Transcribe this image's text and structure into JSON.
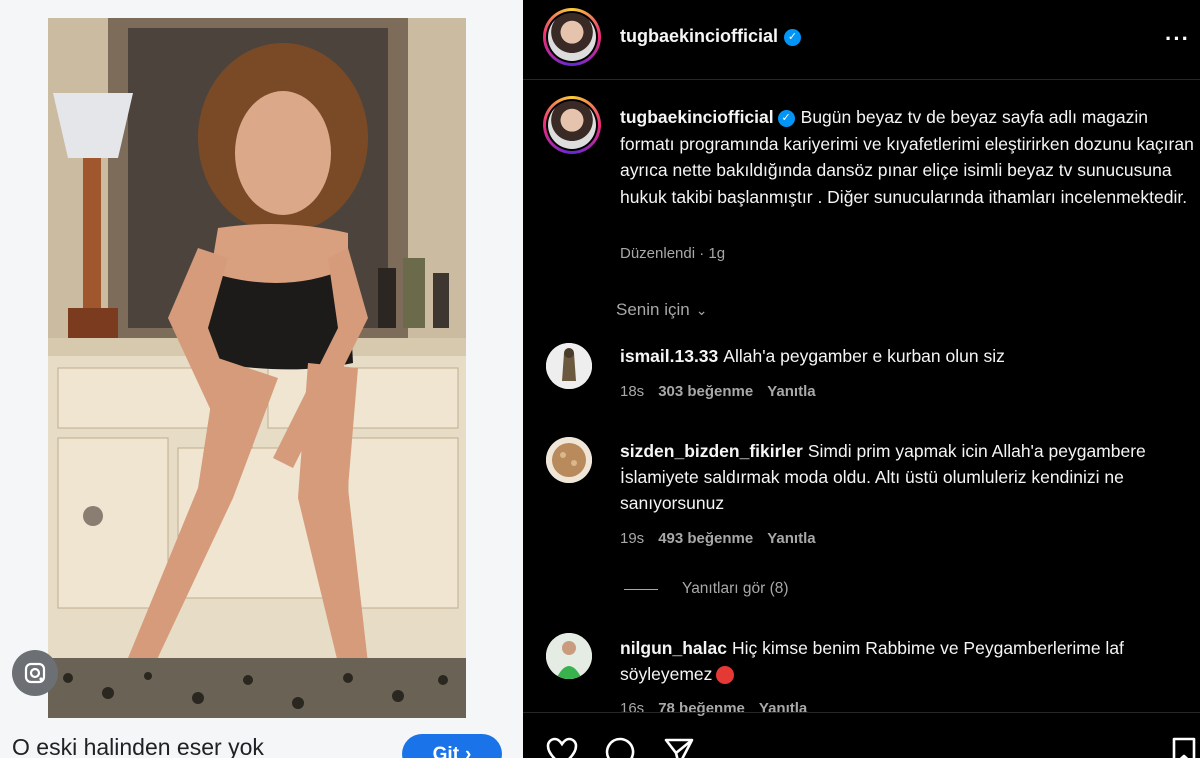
{
  "search_card": {
    "caption": "O eski halinden eser yok",
    "go_button": "Git",
    "go_icon": "chevron-right-icon",
    "lens_icon": "google-lens-icon"
  },
  "post": {
    "header_username": "tugbaekinciofficial",
    "verified_icon": "verified-badge-icon",
    "more_icon": "more-horizontal-icon",
    "caption_username": "tugbaekinciofficial",
    "caption": "Bugün beyaz tv de beyaz sayfa adlı magazin formatı programında kariyerimi ve kıyafetlerimi eleştirirken dozunu kaçıran ayrıca nette bakıldığında dansöz pınar eliçe isimli beyaz tv sunucusuna hukuk takibi başlanmıştır . Diğer sunucularında ithamları incelenmektedir.",
    "edited_label": "Düzenlendi · 1g",
    "for_you_label": "Senin için",
    "comments": [
      {
        "username": "ismail.13.33",
        "text": "Allah'a peygamber e kurban olun siz",
        "time": "18s",
        "likes": "303 beğenme",
        "reply": "Yanıtla"
      },
      {
        "username": "sizden_bizden_fikirler",
        "text": "Simdi prim yapmak icin Allah'a peygambere İslamiyete saldırmak moda oldu. Altı üstü olumluleriz kendinizi ne sanıyorsunuz",
        "time": "19s",
        "likes": "493 beğenme",
        "reply": "Yanıtla"
      },
      {
        "username": "nilgun_halac",
        "text": "Hiç kimse benim Rabbime ve Peygamberlerime laf söyleyemez",
        "time": "16s",
        "likes": "78 beğenme",
        "reply": "Yanıtla"
      }
    ],
    "view_replies": "Yanıtları gör (8)",
    "actions": [
      "heart-icon",
      "comment-icon",
      "share-icon",
      "bookmark-icon"
    ]
  },
  "colors": {
    "instagram_bg": "#000000",
    "muted_text": "#a8a8a8",
    "verified_blue": "#0095f6",
    "google_blue": "#1a73e8"
  }
}
